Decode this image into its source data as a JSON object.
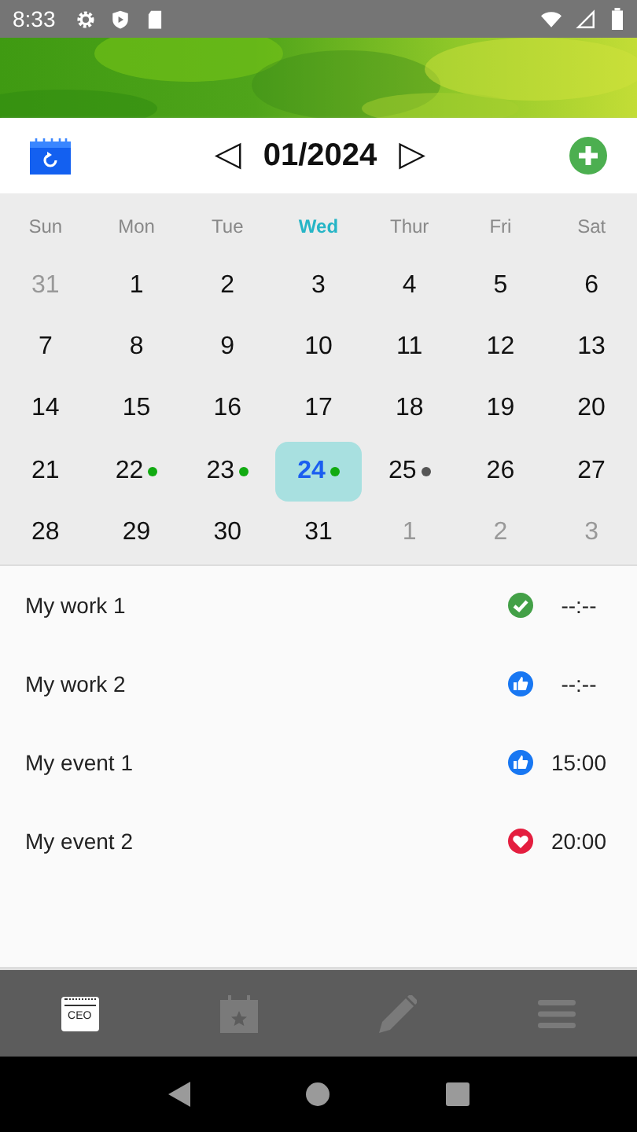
{
  "status_bar": {
    "time": "8:33"
  },
  "header": {
    "month": "01/2024",
    "prev": "◁",
    "next": "▷"
  },
  "weekdays": [
    {
      "label": "Sun",
      "selected": false
    },
    {
      "label": "Mon",
      "selected": false
    },
    {
      "label": "Tue",
      "selected": false
    },
    {
      "label": "Wed",
      "selected": true
    },
    {
      "label": "Thur",
      "selected": false
    },
    {
      "label": "Fri",
      "selected": false
    },
    {
      "label": "Sat",
      "selected": false
    }
  ],
  "weeks": [
    [
      {
        "day": "31",
        "muted": true,
        "selected": false
      },
      {
        "day": "1",
        "muted": false,
        "selected": false
      },
      {
        "day": "2",
        "muted": false,
        "selected": false
      },
      {
        "day": "3",
        "muted": false,
        "selected": false
      },
      {
        "day": "4",
        "muted": false,
        "selected": false
      },
      {
        "day": "5",
        "muted": false,
        "selected": false
      },
      {
        "day": "6",
        "muted": false,
        "selected": false
      }
    ],
    [
      {
        "day": "7",
        "muted": false,
        "selected": false
      },
      {
        "day": "8",
        "muted": false,
        "selected": false
      },
      {
        "day": "9",
        "muted": false,
        "selected": false
      },
      {
        "day": "10",
        "muted": false,
        "selected": false
      },
      {
        "day": "11",
        "muted": false,
        "selected": false
      },
      {
        "day": "12",
        "muted": false,
        "selected": false
      },
      {
        "day": "13",
        "muted": false,
        "selected": false
      }
    ],
    [
      {
        "day": "14",
        "muted": false,
        "selected": false
      },
      {
        "day": "15",
        "muted": false,
        "selected": false
      },
      {
        "day": "16",
        "muted": false,
        "selected": false
      },
      {
        "day": "17",
        "muted": false,
        "selected": false
      },
      {
        "day": "18",
        "muted": false,
        "selected": false
      },
      {
        "day": "19",
        "muted": false,
        "selected": false
      },
      {
        "day": "20",
        "muted": false,
        "selected": false
      }
    ],
    [
      {
        "day": "21",
        "muted": false,
        "selected": false
      },
      {
        "day": "22",
        "muted": false,
        "selected": false,
        "color": "#11aa11"
      },
      {
        "day": "23",
        "muted": false,
        "selected": false,
        "color": "#11aa11"
      },
      {
        "day": "24",
        "muted": false,
        "selected": true,
        "color": "#11aa11"
      },
      {
        "day": "25",
        "muted": false,
        "selected": false,
        "color": "#555555"
      },
      {
        "day": "26",
        "muted": false,
        "selected": false
      },
      {
        "day": "27",
        "muted": false,
        "selected": false
      }
    ],
    [
      {
        "day": "28",
        "muted": false,
        "selected": false
      },
      {
        "day": "29",
        "muted": false,
        "selected": false
      },
      {
        "day": "30",
        "muted": false,
        "selected": false
      },
      {
        "day": "31",
        "muted": false,
        "selected": false
      },
      {
        "day": "1",
        "muted": true,
        "selected": false
      },
      {
        "day": "2",
        "muted": true,
        "selected": false
      },
      {
        "day": "3",
        "muted": true,
        "selected": false
      }
    ]
  ],
  "events": [
    {
      "title": "My work 1",
      "kind": "done",
      "time": "--:--"
    },
    {
      "title": "My work 2",
      "kind": "like",
      "time": "--:--"
    },
    {
      "title": "My event 1",
      "kind": "like",
      "time": "15:00"
    },
    {
      "title": "My event 2",
      "kind": "heart",
      "time": "20:00"
    }
  ],
  "nav": [
    {
      "kind": "ceo",
      "label": "CEO",
      "selected": true
    },
    {
      "kind": "events",
      "selected": false
    },
    {
      "kind": "edit",
      "selected": false
    },
    {
      "kind": "menu",
      "selected": false
    }
  ]
}
